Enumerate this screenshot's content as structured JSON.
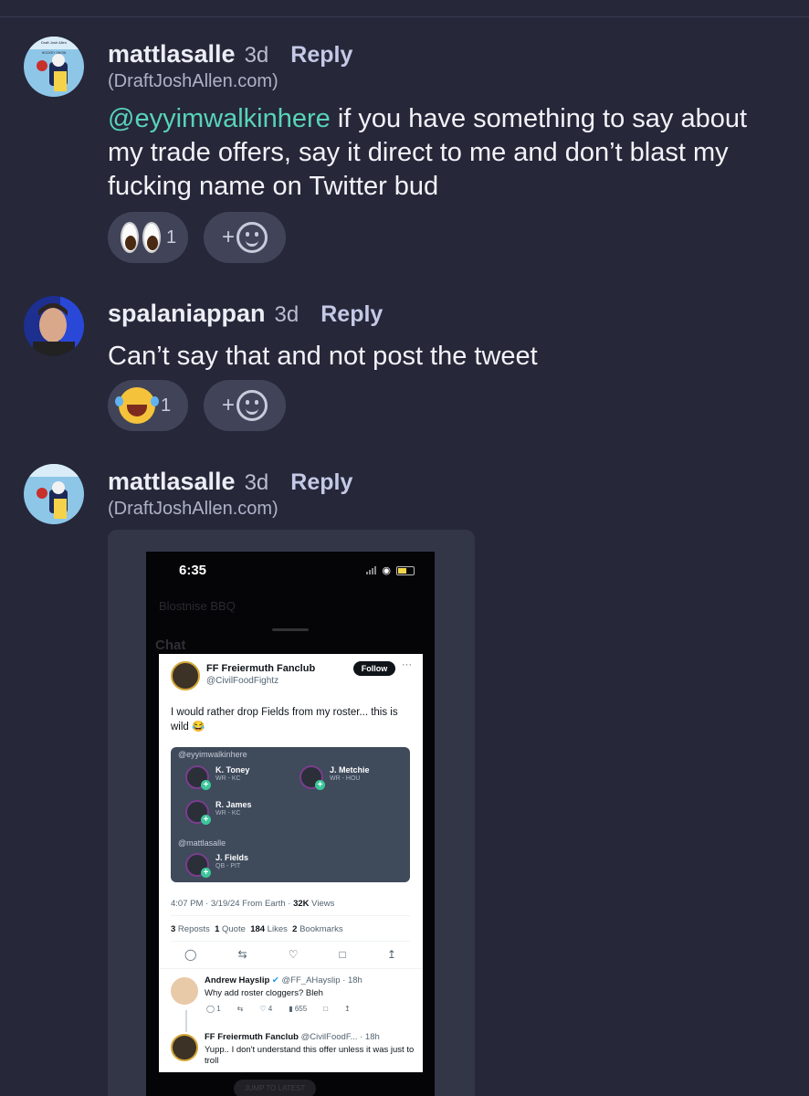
{
  "comments": [
    {
      "username": "mattlasalle",
      "time": "3d",
      "reply_label": "Reply",
      "site": "(DraftJoshAllen.com)",
      "mention": "@eyyimwalkinhere",
      "text": " if you have something to say about my trade offers, say it direct to me and don’t blast my fucking name on Twitter bud",
      "reactions": [
        {
          "emoji": "eyes-emoji",
          "count": "1"
        }
      ],
      "add_reaction_label": "+"
    },
    {
      "username": "spalaniappan",
      "time": "3d",
      "reply_label": "Reply",
      "text": "Can’t say that and not post the tweet",
      "reactions": [
        {
          "emoji": "tears-of-joy-emoji",
          "count": "1"
        }
      ],
      "add_reaction_label": "+"
    },
    {
      "username": "mattlasalle",
      "time": "3d",
      "reply_label": "Reply",
      "site": "(DraftJoshAllen.com)"
    }
  ],
  "avatar_text": {
    "line1": "Draft Josh Allen",
    "line2": "HOCKEY SHOW"
  },
  "screenshot": {
    "phone_time": "6:35",
    "background_app_title": "Blostnise BBQ",
    "background_chat_label": "Chat",
    "tweet": {
      "author_name": "FF Freiermuth Fanclub",
      "author_handle": "@CivilFoodFightz",
      "follow_label": "Follow",
      "text": "I would rather drop Fields from my roster... this is wild 😂",
      "trade": {
        "side1_user": "@eyyimwalkinhere",
        "side1_players": [
          {
            "name": "K. Toney",
            "pos": "WR - KC"
          },
          {
            "name": "J. Metchie",
            "pos": "WR - HOU"
          },
          {
            "name": "R. James",
            "pos": "WR - KC"
          }
        ],
        "side2_user": "@mattlasalle",
        "side2_players": [
          {
            "name": "J. Fields",
            "pos": "QB - PIT"
          }
        ]
      },
      "meta_time": "4:07 PM · 3/19/24 From Earth · ",
      "meta_views_value": "32K",
      "meta_views_label": " Views",
      "stats": {
        "reposts_value": "3",
        "reposts_label": " Reposts",
        "quotes_value": "1",
        "quotes_label": " Quote",
        "likes_value": "184",
        "likes_label": " Likes",
        "bookmarks_value": "2",
        "bookmarks_label": " Bookmarks"
      },
      "replies": [
        {
          "name": "Andrew Hayslip",
          "handle_time": " @FF_AHayslip · 18h",
          "text": "Why add roster cloggers? Bleh",
          "replies_count": "1",
          "likes_count": "4",
          "views_count": "655"
        },
        {
          "name": "FF Freiermuth Fanclub",
          "handle_time": " @CivilFoodF... · 18h",
          "text": "Yupp.. I don't understand this offer unless it was just to troll"
        }
      ],
      "jump_label": "JUMP TO LATEST"
    }
  },
  "colors": {
    "background": "#262739",
    "mention": "#58d3b9",
    "reaction_pill": "#414459"
  }
}
